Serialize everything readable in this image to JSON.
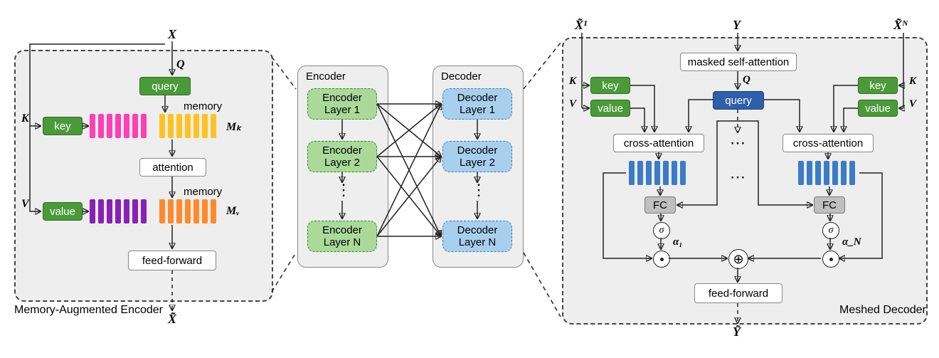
{
  "left": {
    "title": "Memory-Augmented Encoder",
    "input": "X",
    "Q": "Q",
    "K": "K",
    "V": "V",
    "query": "query",
    "key": "key",
    "value": "value",
    "memoryLabel": "memory",
    "Mk": "Mₖ",
    "Mv": "Mᵥ",
    "attention": "attention",
    "feedforward": "feed-forward",
    "output": "X̃"
  },
  "center": {
    "encTitle": "Encoder",
    "decTitle": "Decoder",
    "encLayers": [
      "Encoder\nLayer 1",
      "Encoder\nLayer 2",
      "Encoder\nLayer N"
    ],
    "decLayers": [
      "Decoder\nLayer 1",
      "Decoder\nLayer 2",
      "Decoder\nLayer N"
    ]
  },
  "right": {
    "title": "Meshed Decoder",
    "X1": "X̃¹",
    "XN": "X̃ᴺ",
    "Y": "Y",
    "K": "K",
    "V": "V",
    "Q": "Q",
    "key": "key",
    "value": "value",
    "query": "query",
    "mask": "masked self-attention",
    "cross": "cross-attention",
    "fc": "FC",
    "sigma": "σ",
    "alpha1": "α₁",
    "alphaN": "α_N",
    "feedforward": "feed-forward",
    "output": "Ỹ"
  },
  "colors": {
    "pink": "#ff3fb4",
    "gold": "#ffc321",
    "purple": "#8921b5",
    "orange": "#ff8a2b",
    "blue": "#3a7cc7"
  }
}
